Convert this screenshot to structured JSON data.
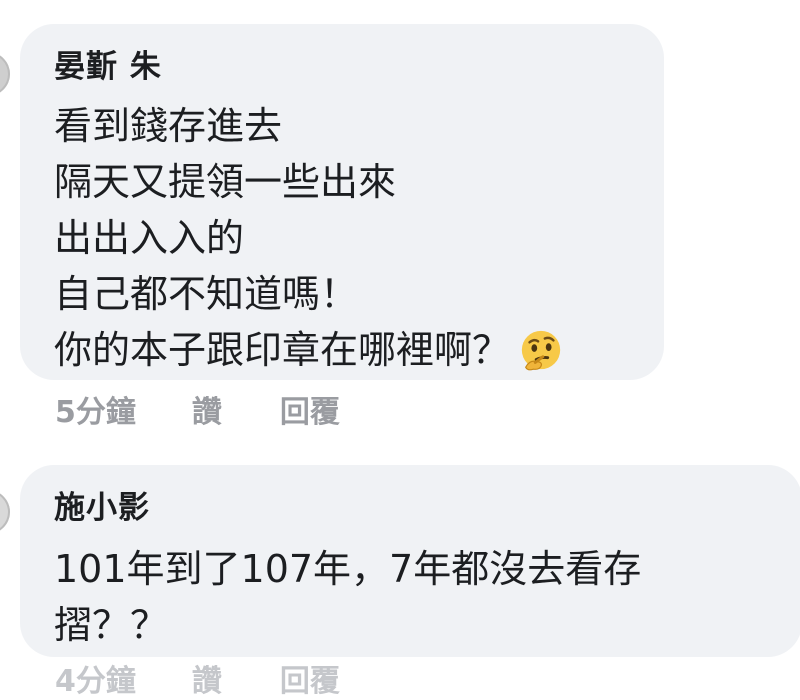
{
  "comments": [
    {
      "author": "晏斳 朱",
      "lines": [
        "看到錢存進去",
        "隔天又提領一些出來",
        "出出入入的",
        "自己都不知道嗎！",
        "你的本子跟印章在哪裡啊？"
      ],
      "emoji": "thinking-face",
      "time": "5分鐘",
      "like_label": "讚",
      "reply_label": "回覆"
    },
    {
      "author": "施小影",
      "lines": [
        "101年到了107年，7年都沒去看存",
        "摺？？"
      ],
      "time": "4分鐘",
      "like_label": "讚",
      "reply_label": "回覆"
    }
  ],
  "colors": {
    "bubble_bg": "#f0f2f5",
    "text": "#1c1e21",
    "meta": "#9a9ca1",
    "emoji_yellow": "#f7c948"
  }
}
